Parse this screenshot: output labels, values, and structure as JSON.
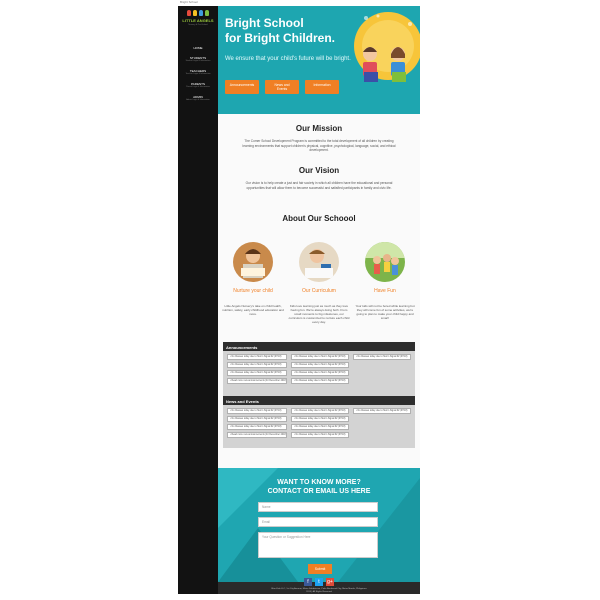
{
  "window": {
    "title_label": "Bright School"
  },
  "sidebar": {
    "logo_title_line1": "LITTLE ANGELS",
    "logo_subtitle": "Nursery & Pre-School",
    "items": [
      {
        "label": "HOME",
        "sub": ""
      },
      {
        "label": "STUDENTS",
        "sub": "Student Login & Information"
      },
      {
        "label": "TEACHERS",
        "sub": "Teacher Login & Information"
      },
      {
        "label": "PARENTS",
        "sub": "Parent Login & Information"
      },
      {
        "label": "ADMIN",
        "sub": "Admin Login & Information"
      }
    ]
  },
  "hero": {
    "title_line1": "Bright School",
    "title_line2": "for Bright Children.",
    "subtitle": "We ensure that your child's future will be bright.",
    "buttons": [
      "Announcements",
      "News and Events",
      "Information"
    ]
  },
  "mission": {
    "title": "Our Mission",
    "text": "The Comer School Development Program is committed to the total development of all children by creating learning environments that support children's physical, cognitive, psychological, language, social, and ethical development."
  },
  "vision": {
    "title": "Our Vision",
    "text": "Our vision is to help create a just and fair society in which all children have the educational and personal opportunities that will allow them to become successful and satisfied participants in family and civic life."
  },
  "about": {
    "title": "About Our Schoool",
    "cols": [
      {
        "title": "Nurture your child",
        "text": "Little Angels Nursery's take on child health, nutrition, safety, early childhood education and more."
      },
      {
        "title": "Our Curriculum",
        "text": "Kids love learning just as much as they love having fun. We're always doing both. From small moments to big milestones, our curriculum is customized to nurture each child every day."
      },
      {
        "title": "Have Fun",
        "text": "Your kids will not be bored while learning but they will come fun of some activities, we're going to plan to make your child happy and smart!"
      }
    ]
  },
  "announcements": {
    "heading": "Announcements",
    "col1": [
      "• No Classes today due to Storm Signal #2 (07/18)",
      "• No Classes today due to Storm Signal #2 (07/18)",
      "• No Classes today due to Storm Signal #2 (07/18)",
      "• Read more new announcements (for December 2018)"
    ],
    "col2": [
      "• No Classes today due to Storm Signal #2 (07/18)",
      "• No Classes today due to Storm Signal #2 (07/18)",
      "• No Classes today due to Storm Signal #2 (07/18)",
      "• No Classes today due to Storm Signal #2 (07/18)"
    ],
    "col3": [
      "• No Classes today due to Storm Signal #2 (07/18)"
    ]
  },
  "news": {
    "heading": "News and Events",
    "col1": [
      "• No Classes today due to Storm Signal #2 (07/18)",
      "• No Classes today due to Storm Signal #2 (07/18)",
      "• No Classes today due to Storm Signal #2 (07/18)",
      "• Read more new announcements (for December 2018)"
    ],
    "col2": [
      "• No Classes today due to Storm Signal #2 (07/18)",
      "• No Classes today due to Storm Signal #2 (07/18)",
      "• No Classes today due to Storm Signal #2 (07/18)",
      "• No Classes today due to Storm Signal #2 (07/18)"
    ],
    "col3": [
      "• No Classes today due to Storm Signal #2 (07/18)"
    ]
  },
  "contact": {
    "title_line1": "WANT TO KNOW MORE?",
    "title_line2": "CONTACT OR EMAIL US HERE",
    "name_placeholder": "Name",
    "email_placeholder": "Email",
    "question_placeholder": "Your Question or Suggestion Here",
    "submit_label": "Submit"
  },
  "footer": {
    "socials": [
      {
        "icon": "facebook-icon",
        "glyph": "f",
        "color": "#3b5998"
      },
      {
        "icon": "twitter-icon",
        "glyph": "t",
        "color": "#1da1f2"
      },
      {
        "icon": "google-plus-icon",
        "glyph": "g+",
        "color": "#dd4b39"
      }
    ],
    "address": "Blue Kids LLC, 1st City Avenue, Metro Subdivision, Palm Boulevard City, Metro Manila, Philippines",
    "copyright": "2013 | All Rights Reserved"
  },
  "colors": {
    "accent": "#f07f24",
    "teal": "#1ea6b0",
    "sidebar": "#121212",
    "logo_green": "#9ccc3c"
  }
}
